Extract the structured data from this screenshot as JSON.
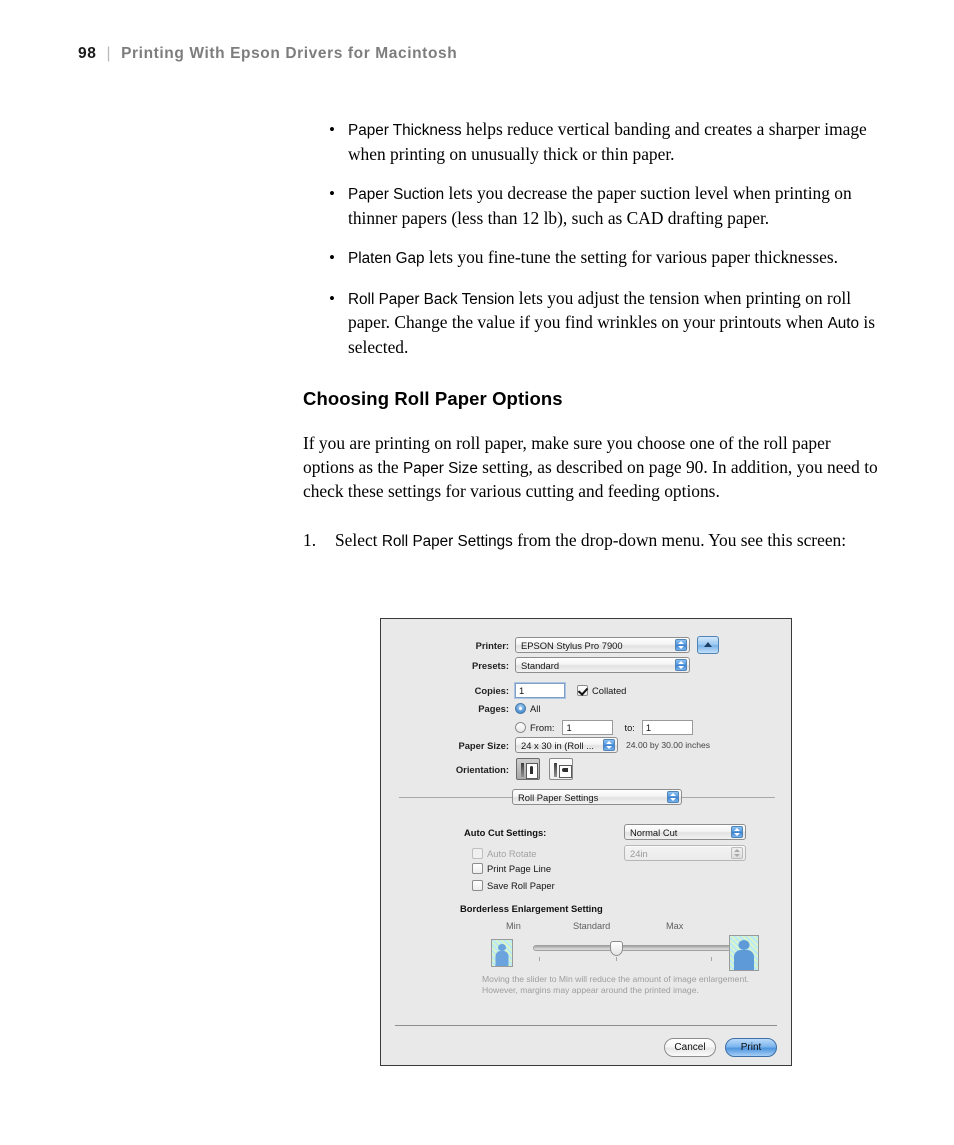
{
  "header": {
    "page_number": "98",
    "separator": "|",
    "title": "Printing With Epson Drivers for Macintosh"
  },
  "bullets": [
    {
      "term": "Paper Thickness",
      "text": " helps reduce vertical banding and creates a sharper image when printing on unusually thick or thin paper."
    },
    {
      "term": "Paper Suction",
      "text": " lets you decrease the paper suction level when printing on thinner papers (less than 12 lb), such as CAD drafting paper."
    },
    {
      "term": "Platen Gap",
      "text": " lets you fine-tune the setting for various paper thicknesses."
    },
    {
      "term": "Roll Paper Back Tension",
      "text": " lets you adjust the tension when printing on roll paper. Change the value if you find wrinkles on your printouts when ",
      "term2": "Auto",
      "text2": " is selected."
    }
  ],
  "section": {
    "heading": "Choosing Roll Paper Options",
    "para_part1": "If you are printing on roll paper, make sure you choose one of the roll paper options as the ",
    "para_term": "Paper Size",
    "para_part2": " setting, as described on page 90. In addition, you need to check these settings for various cutting and feeding options."
  },
  "step": {
    "number": "1.",
    "part1": "Select ",
    "term": "Roll Paper Settings",
    "part2": " from the drop-down menu. You see this screen:"
  },
  "dialog": {
    "printer": {
      "label": "Printer:",
      "value": "EPSON Stylus Pro 7900"
    },
    "presets": {
      "label": "Presets:",
      "value": "Standard"
    },
    "copies": {
      "label": "Copies:",
      "value": "1",
      "collated_label": "Collated",
      "collated_checked": true
    },
    "pages": {
      "label": "Pages:",
      "all_label": "All",
      "all_selected": true,
      "from_label": "From:",
      "from_value": "1",
      "to_label": "to:",
      "to_value": "1"
    },
    "paper_size": {
      "label": "Paper Size:",
      "value": "24 x 30 in (Roll ...",
      "dimensions": "24.00 by 30.00 inches"
    },
    "orientation": {
      "label": "Orientation:",
      "portrait_selected": true
    },
    "pane_popup": {
      "value": "Roll Paper Settings"
    },
    "auto_cut": {
      "label": "Auto Cut Settings:",
      "value": "Normal Cut"
    },
    "auto_rotate": {
      "label": "Auto Rotate",
      "checked": false,
      "enabled": false,
      "size_value": "24in"
    },
    "print_page_line": {
      "label": "Print Page Line",
      "checked": false
    },
    "save_roll_paper": {
      "label": "Save Roll Paper",
      "checked": false
    },
    "borderless": {
      "title": "Borderless Enlargement Setting",
      "min_label": "Min",
      "standard_label": "Standard",
      "max_label": "Max",
      "slider_position_percent": 50,
      "caption_line1": "Moving the slider to Min will reduce the amount of image enlargement.",
      "caption_line2": "However, margins may appear around the printed image."
    },
    "buttons": {
      "cancel": "Cancel",
      "print": "Print"
    }
  },
  "colors": {
    "accent_blue": "#4f95dd",
    "dialog_bg": "#e9e9e9",
    "header_gray": "#7d7d7d"
  }
}
